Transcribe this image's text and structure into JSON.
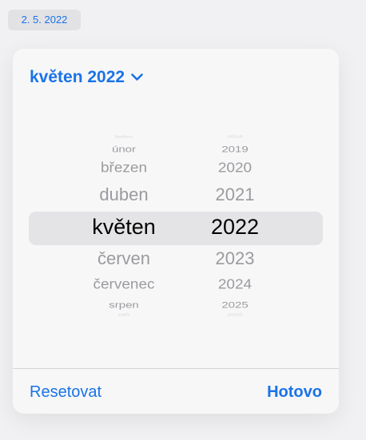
{
  "date_chip": "2. 5. 2022",
  "picker": {
    "title": "květen 2022",
    "months": [
      "leden",
      "únor",
      "březen",
      "duben",
      "květen",
      "červen",
      "červenec",
      "srpen",
      "září"
    ],
    "years": [
      "2018",
      "2019",
      "2020",
      "2021",
      "2022",
      "2023",
      "2024",
      "2025",
      "2026"
    ],
    "selected_month": "květen",
    "selected_year": "2022"
  },
  "footer": {
    "reset_label": "Resetovat",
    "done_label": "Hotovo"
  },
  "colors": {
    "accent": "#1a73e8",
    "selection_bg": "#e4e4e6"
  }
}
